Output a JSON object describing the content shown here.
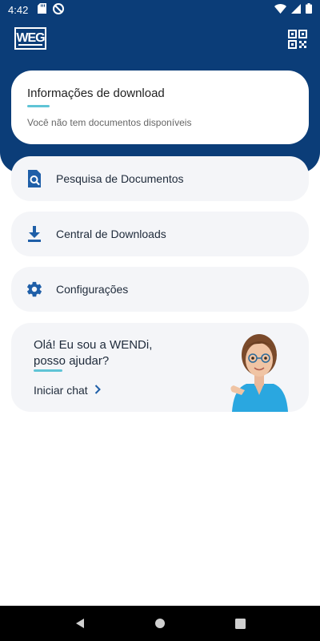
{
  "status_bar": {
    "time": "4:42"
  },
  "header": {
    "logo_text": "WEG"
  },
  "info_card": {
    "title": "Informações de download",
    "subtitle": "Você não tem documentos disponíveis"
  },
  "menu": [
    {
      "label": "Pesquisa de Documentos",
      "icon": "document-search-icon"
    },
    {
      "label": "Central de Downloads",
      "icon": "download-icon"
    },
    {
      "label": "Configurações",
      "icon": "gear-icon"
    }
  ],
  "wendi": {
    "greeting": "Olá! Eu sou a WENDi, posso ajudar?",
    "chat_label": "Iniciar chat"
  },
  "colors": {
    "primary": "#0b3d78",
    "accent": "#5fc4d6",
    "icon": "#1f5fa8",
    "card_bg": "#f4f5f8"
  }
}
